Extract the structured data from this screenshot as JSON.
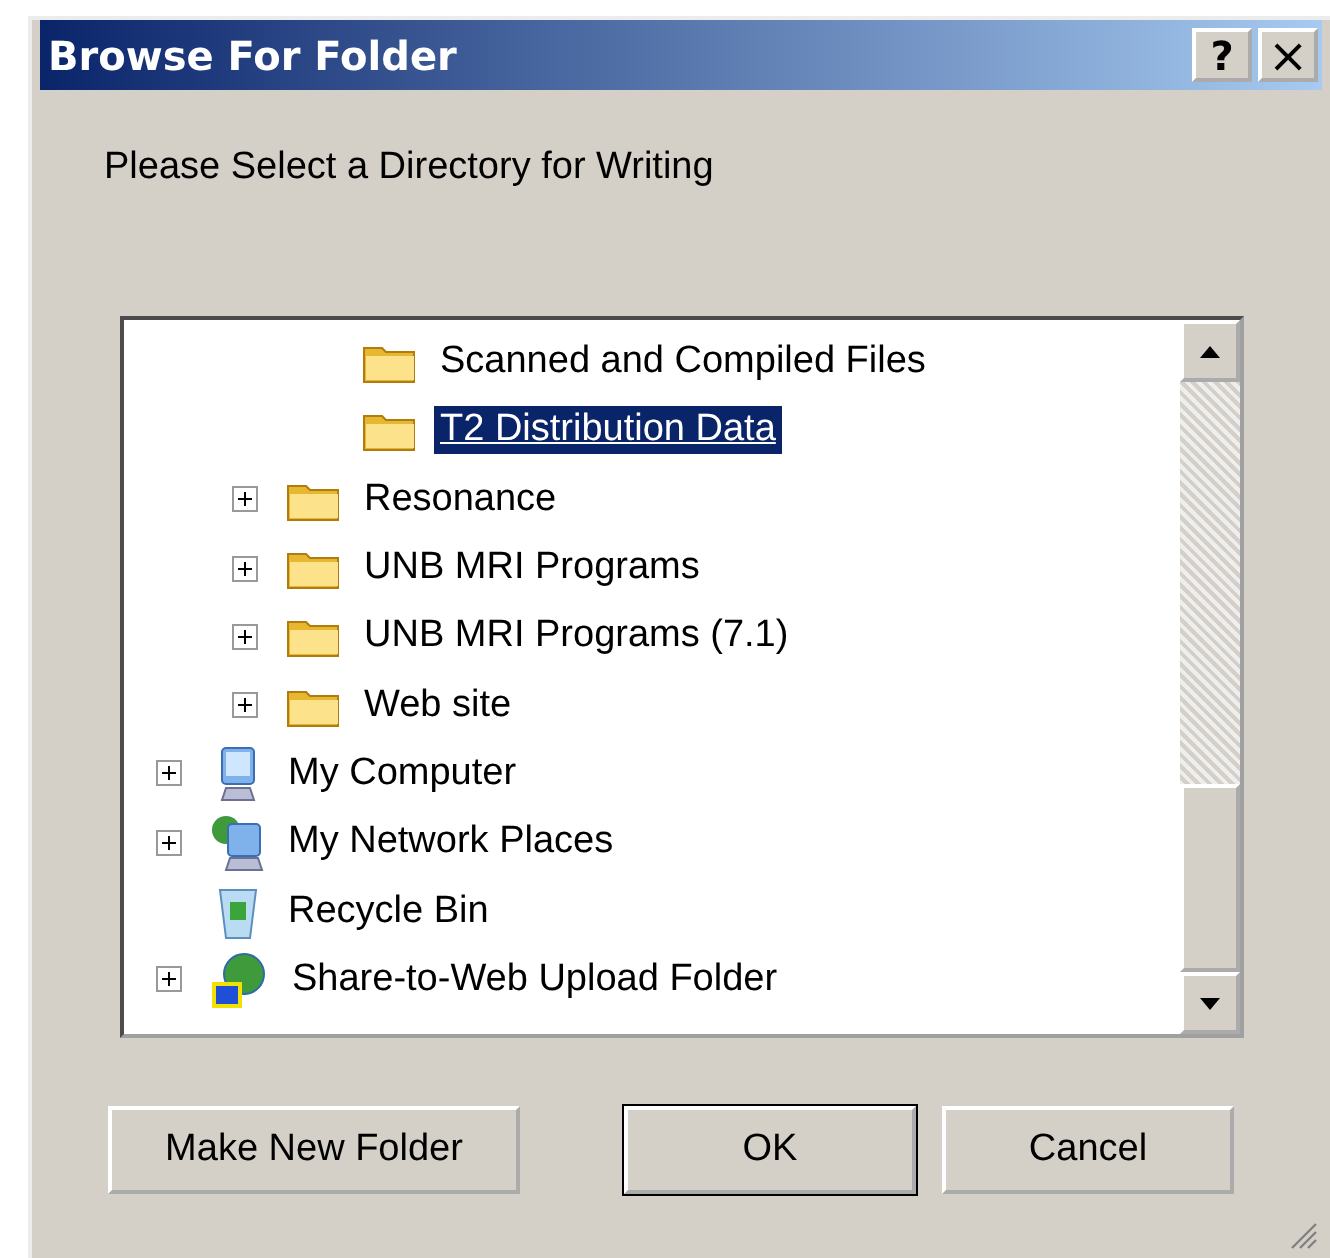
{
  "window": {
    "title": "Browse For Folder",
    "help_button": "?",
    "close_button": "×"
  },
  "prompt": "Please Select a Directory for Writing",
  "tree": {
    "items": [
      {
        "children": [
          {
            "children": [
              {
                "label": "Scanned and Compiled Files",
                "kind": "folder",
                "expandable": false,
                "selected": false
              },
              {
                "label": "T2 Distribution Data",
                "kind": "folder",
                "expandable": false,
                "selected": true
              }
            ]
          },
          {
            "label": "Resonance",
            "kind": "folder",
            "expandable": true,
            "selected": false
          },
          {
            "label": "UNB MRI Programs",
            "kind": "folder",
            "expandable": true,
            "selected": false
          },
          {
            "label": "UNB MRI Programs (7.1)",
            "kind": "folder",
            "expandable": true,
            "selected": false
          },
          {
            "label": "Web site",
            "kind": "folder",
            "expandable": true,
            "selected": false
          }
        ]
      },
      {
        "label": "My Computer",
        "kind": "computer",
        "expandable": true,
        "selected": false
      },
      {
        "label": "My Network Places",
        "kind": "network",
        "expandable": true,
        "selected": false
      },
      {
        "label": "Recycle Bin",
        "kind": "recycle",
        "expandable": false,
        "selected": false
      },
      {
        "label": "Share-to-Web Upload Folder",
        "kind": "share",
        "expandable": true,
        "selected": false
      }
    ]
  },
  "buttons": [
    {
      "label": "Make New Folder",
      "default": false
    },
    {
      "label": "OK",
      "default": true
    },
    {
      "label": "Cancel",
      "default": false
    }
  ]
}
